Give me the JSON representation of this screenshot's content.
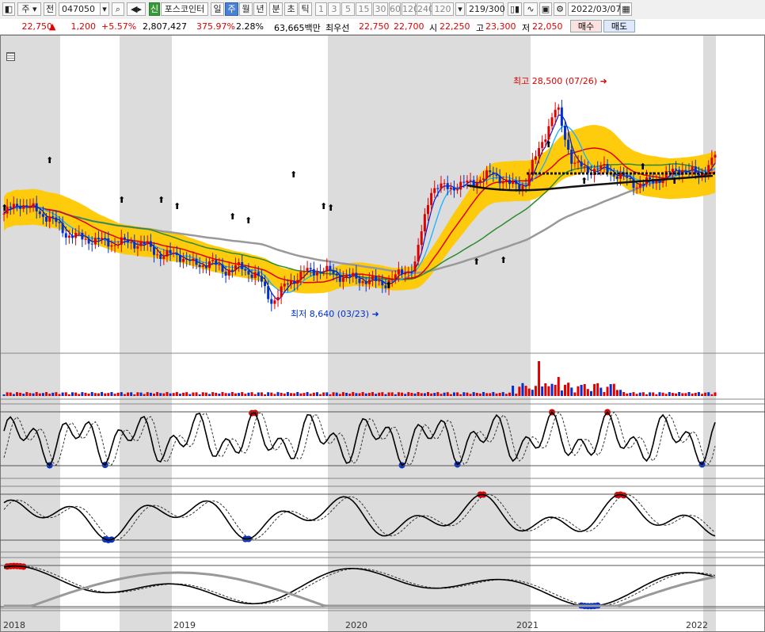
{
  "toolbar": {
    "market": "주",
    "code_type": "전",
    "code": "047050",
    "stock_badge": "신",
    "stock_name": "포스코인터",
    "periods": [
      "일",
      "주",
      "월",
      "년",
      "분",
      "초",
      "틱"
    ],
    "active_period": "주",
    "intervals": [
      "1",
      "3",
      "5",
      "15",
      "30",
      "60",
      "120",
      "240",
      "120"
    ],
    "count": "219/300",
    "date": "2022/03/07"
  },
  "quote": {
    "price": "22,750",
    "change": "1,200",
    "change_pct": "+5.57%",
    "volume": "2,807,427",
    "vol_ratio": "375.97%",
    "turnover": "2.28%",
    "amount": "63,665백만",
    "best_ask_label": "최우선",
    "ask": "22,750",
    "bid": "22,700",
    "open_label": "시",
    "open": "22,250",
    "high_label": "고",
    "high": "23,300",
    "low_label": "저",
    "low": "22,050",
    "buy_label": "매수",
    "sell_label": "매도"
  },
  "annotations": {
    "high": "최고 28,500 (07/26)",
    "low": "최저 8,640 (03/23)"
  },
  "x_axis": [
    "2018",
    "2019",
    "2020",
    "2021",
    "2022"
  ],
  "colors": {
    "up": "#e00000",
    "down": "#0030d0",
    "band": "#ffc800",
    "shade": "#dcdcdc"
  },
  "chart_data": {
    "type": "line",
    "title": "",
    "series": [
      {
        "values": [
          17500,
          18500,
          17800,
          17000,
          15600,
          15200,
          15000,
          14800,
          14900,
          14600,
          13600,
          13800,
          12800,
          13000,
          12300,
          12600,
          11800,
          9400,
          11200,
          12100,
          12400,
          11900,
          11600,
          11400,
          11100,
          11900,
          12800,
          19800,
          19900,
          20100,
          20600,
          21200,
          20100,
          20200,
          24000,
          27200,
          22000,
          21500,
          21600,
          20900,
          20200,
          20400,
          21100,
          21700,
          20900,
          22750
        ]
      }
    ],
    "x": [
      "2018-01",
      "2018-02",
      "2018-04",
      "2018-05",
      "2018-07",
      "2018-08",
      "2018-10",
      "2018-11",
      "2019-01",
      "2019-02",
      "2019-04",
      "2019-05",
      "2019-07",
      "2019-08",
      "2019-10",
      "2019-11",
      "2020-01",
      "2020-03",
      "2020-04",
      "2020-06",
      "2020-07",
      "2020-08",
      "2020-09",
      "2020-10",
      "2020-11",
      "2020-12",
      "2021-01",
      "2021-02",
      "2021-03",
      "2021-04",
      "2021-05",
      "2021-06",
      "2021-07",
      "2021-08",
      "2021-07-26",
      "2021-08-02",
      "2021-08-30",
      "2021-09",
      "2021-10",
      "2021-11",
      "2021-12",
      "2022-01",
      "2022-01-20",
      "2022-02",
      "2022-02-20",
      "2022-03-07"
    ],
    "ylim": [
      8000,
      30000
    ]
  }
}
